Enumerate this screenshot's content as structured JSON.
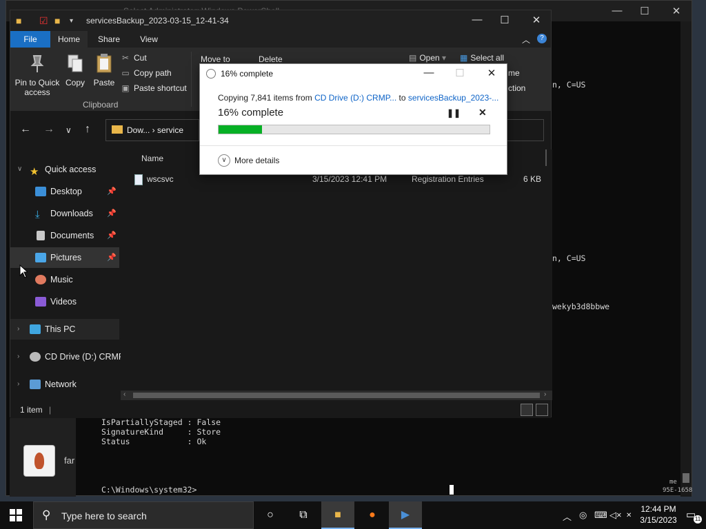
{
  "powershell": {
    "title": "Select Administrator: Windows PowerShell",
    "right_fragments": [
      "n, C=US",
      "n, C=US",
      "wekyb3d8bbwe",
      "me",
      "95E-1658"
    ],
    "lines": [
      "IsPartiallyStaged : False",
      "SignatureKind     : Store",
      "Status            : Ok",
      "C:\\Windows\\system32>"
    ]
  },
  "background_app": {
    "label": "far"
  },
  "explorer": {
    "title": "servicesBackup_2023-03-15_12-41-34",
    "tabs": {
      "file": "File",
      "home": "Home",
      "share": "Share",
      "view": "View"
    },
    "ribbon": {
      "pin": "Pin to Quick access",
      "copy": "Copy",
      "paste": "Paste",
      "cut": "Cut",
      "copy_path": "Copy path",
      "paste_shortcut": "Paste shortcut",
      "group_label": "Clipboard",
      "partial_move": "Move to",
      "partial_delete": "Delete",
      "open": "Open",
      "select_all": "Select all",
      "partial_me": "me",
      "partial_ction": "ction"
    },
    "address": {
      "path": "Dow... › service"
    },
    "nav": {
      "quick_access": "Quick access",
      "desktop": "Desktop",
      "downloads": "Downloads",
      "documents": "Documents",
      "pictures": "Pictures",
      "music": "Music",
      "videos": "Videos",
      "this_pc": "This PC",
      "cd_drive": "CD Drive (D:) CRMP",
      "network": "Network"
    },
    "columns": {
      "name": "Name"
    },
    "file": {
      "name": "wscsvc",
      "date": "3/15/2023 12:41 PM",
      "type": "Registration Entries",
      "size": "6 KB"
    },
    "status": {
      "count": "1 item",
      "sep": "|"
    }
  },
  "dialog": {
    "title": "16% complete",
    "copying_prefix": "Copying 7,841 items from ",
    "source": "CD Drive (D:) CRMP...",
    "to": " to ",
    "destination": "servicesBackup_2023-...",
    "percent_label": "16% complete",
    "progress": 0.16,
    "more_details": "More details"
  },
  "taskbar": {
    "search_placeholder": "Type here to search",
    "time": "12:44 PM",
    "date": "3/15/2023",
    "notification_count": "11"
  }
}
